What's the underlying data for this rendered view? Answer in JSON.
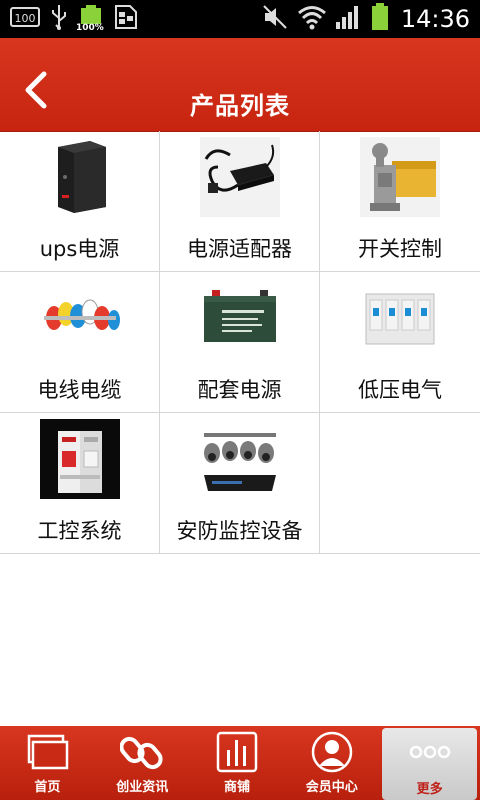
{
  "status_bar": {
    "left_icons": [
      "sd-card-icon",
      "usb-icon",
      "battery-full-icon",
      "keyboard-icon"
    ],
    "battery_text": "100%",
    "sd_text": "100",
    "time": "14:36"
  },
  "header": {
    "title": "产品列表",
    "accent_color": "#cf2c17"
  },
  "products": [
    {
      "label": "ups电源",
      "icon": "ups-device-icon"
    },
    {
      "label": "电源适配器",
      "icon": "power-adapter-icon"
    },
    {
      "label": "开关控制",
      "icon": "limit-switch-icon"
    },
    {
      "label": "电线电缆",
      "icon": "wire-cable-icon"
    },
    {
      "label": "配套电源",
      "icon": "battery-pack-icon"
    },
    {
      "label": "低压电气",
      "icon": "circuit-breaker-icon"
    },
    {
      "label": "工控系统",
      "icon": "control-breaker-icon"
    },
    {
      "label": "安防监控设备",
      "icon": "security-camera-icon"
    }
  ],
  "tabbar": {
    "items": [
      {
        "label": "首页",
        "icon": "home-pages-icon"
      },
      {
        "label": "创业资讯",
        "icon": "link-icon"
      },
      {
        "label": "商铺",
        "icon": "shop-chart-icon"
      },
      {
        "label": "会员中心",
        "icon": "member-avatar-icon"
      },
      {
        "label": "更多",
        "icon": "more-dots-icon"
      }
    ],
    "active_index": 4
  }
}
